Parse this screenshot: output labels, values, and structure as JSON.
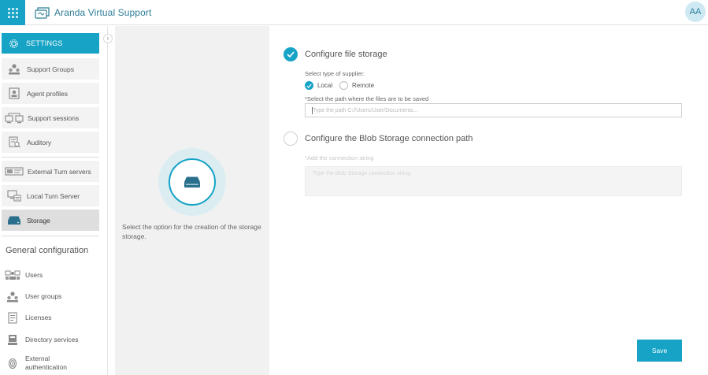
{
  "app": {
    "title": "Aranda Virtual Support",
    "avatar_initials": "AA"
  },
  "colors": {
    "accent": "#16a3c6",
    "sidebar_active": "#dedede",
    "info_panel": "#f1f1f1"
  },
  "sidebar": {
    "settings_label": "SETTINGS",
    "items": [
      {
        "label": "Support Groups",
        "icon": "support-groups-icon"
      },
      {
        "label": "Agent profiles",
        "icon": "agent-profile-icon"
      },
      {
        "label": "Support sessions",
        "icon": "support-sessions-icon"
      },
      {
        "label": "Auditory",
        "icon": "auditory-icon"
      },
      {
        "label": "External Turn servers",
        "icon": "external-server-icon"
      },
      {
        "label": "Local Turn Server",
        "icon": "local-server-icon"
      },
      {
        "label": "Storage",
        "icon": "storage-icon",
        "active": true
      }
    ],
    "general_title": "General configuration",
    "general_items": [
      {
        "label": "Users",
        "icon": "users-icon"
      },
      {
        "label": "User groups",
        "icon": "user-groups-icon"
      },
      {
        "label": "Licenses",
        "icon": "licenses-icon"
      },
      {
        "label": "Directory services",
        "icon": "directory-icon"
      },
      {
        "label": "External authentication",
        "icon": "fingerprint-icon"
      }
    ]
  },
  "info": {
    "text": "Select the option for the creation of the storage storage."
  },
  "form": {
    "file_storage": {
      "title": "Configure file storage",
      "checked": true,
      "supplier_label": "Select type of supplier:",
      "options": [
        {
          "label": "Local",
          "selected": true
        },
        {
          "label": "Remote",
          "selected": false
        }
      ],
      "path_label": "*Select the path where the files are to be saved",
      "path_placeholder": "Type the path C://Users/User/Documents..."
    },
    "blob_storage": {
      "title": "Configure the Blob Storage connection path",
      "checked": false,
      "connection_label": "*Add the connection string",
      "connection_placeholder": "Type the Blob Storage connection string"
    },
    "save_label": "Save"
  }
}
